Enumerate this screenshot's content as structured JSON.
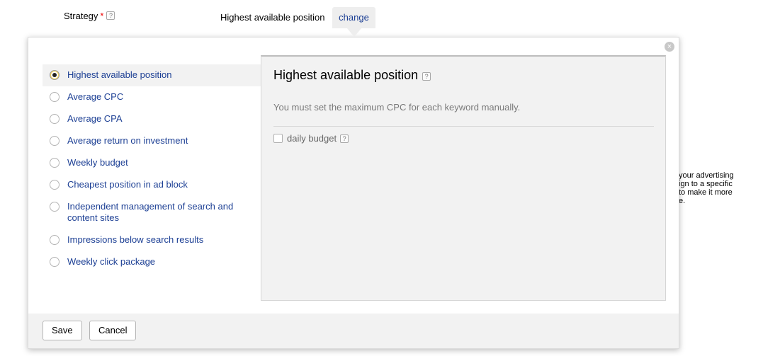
{
  "form": {
    "strategy_label": "Strategy",
    "required_mark": "*",
    "help_glyph": "?",
    "current_strategy": "Highest available position",
    "change_label": "change"
  },
  "background_hint": {
    "lines": [
      "your advertising",
      "ign to a specific",
      "to make it more",
      "e."
    ]
  },
  "popup": {
    "close_glyph": "×",
    "options": [
      {
        "label": "Highest available position",
        "selected": true
      },
      {
        "label": "Average CPC",
        "selected": false
      },
      {
        "label": "Average CPA",
        "selected": false
      },
      {
        "label": "Average return on investment",
        "selected": false
      },
      {
        "label": "Weekly budget",
        "selected": false
      },
      {
        "label": "Cheapest position in ad block",
        "selected": false
      },
      {
        "label": "Independent management of search and content sites",
        "selected": false
      },
      {
        "label": "Impressions below search results",
        "selected": false
      },
      {
        "label": "Weekly click package",
        "selected": false
      }
    ],
    "detail": {
      "title": "Highest available position",
      "description": "You must set the maximum CPC for each keyword manually.",
      "daily_budget_label": "daily budget",
      "daily_budget_checked": false
    },
    "footer": {
      "save_label": "Save",
      "cancel_label": "Cancel"
    }
  },
  "colors": {
    "link": "#1c3f94",
    "required": "#ee0000",
    "panel_bg": "#f2f2f2"
  }
}
